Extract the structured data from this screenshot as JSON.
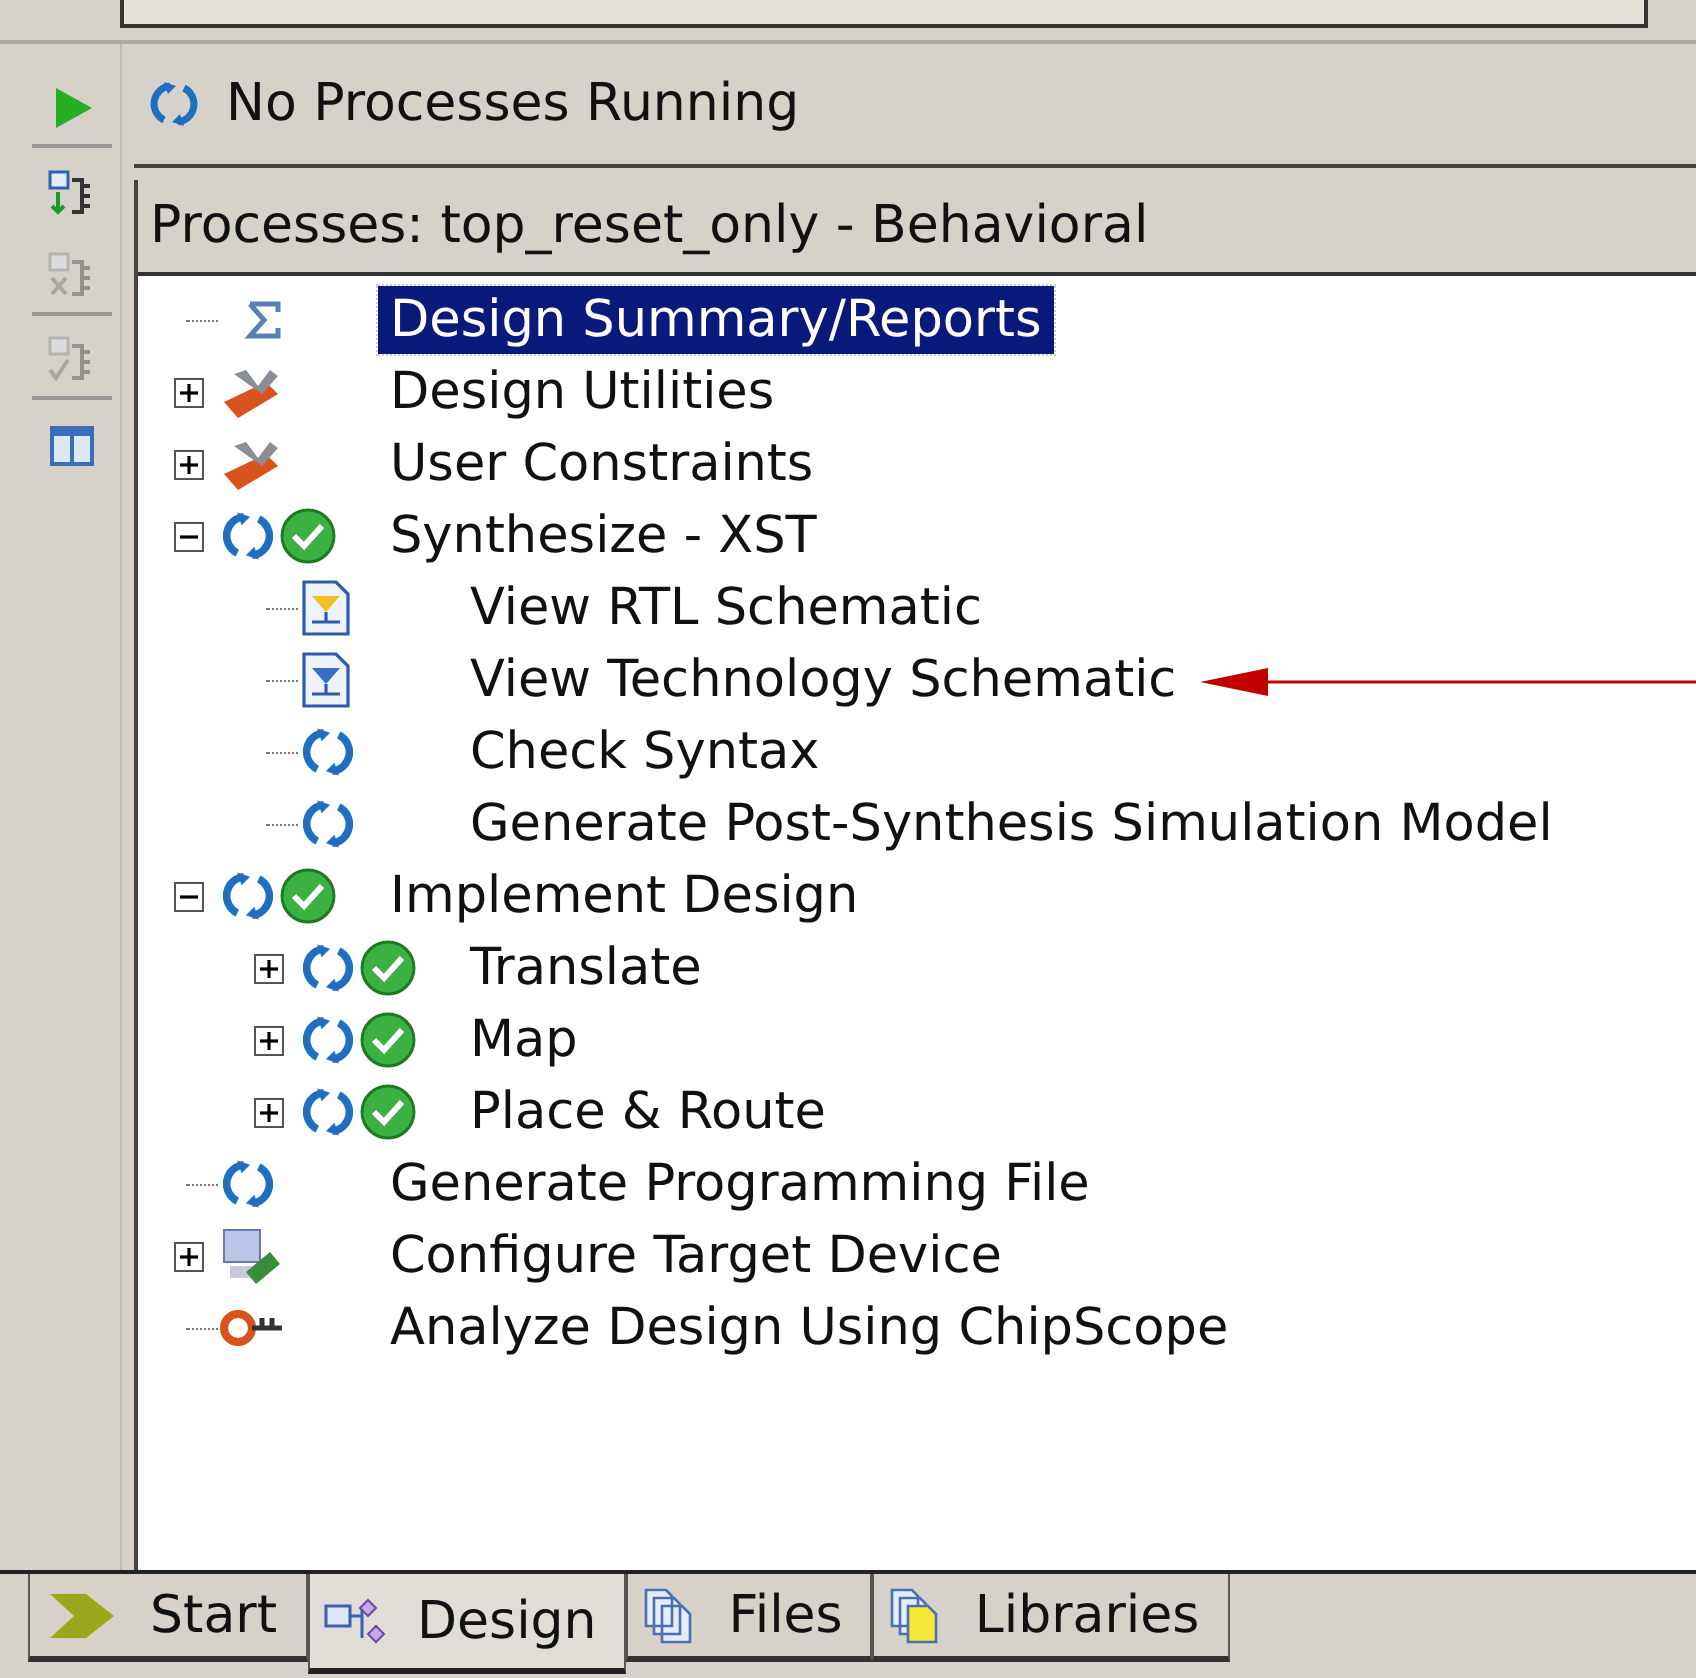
{
  "toolbar": [
    {
      "kind": "run",
      "disabled": false
    },
    {
      "kind": "implement-top",
      "disabled": false
    },
    {
      "kind": "rerun-all",
      "disabled": true
    },
    {
      "kind": "check-all",
      "disabled": true
    },
    {
      "kind": "panes",
      "disabled": false
    }
  ],
  "status": {
    "text": "No Processes Running"
  },
  "processes": {
    "title": "Processes: top_reset_only - Behavioral",
    "items": [
      {
        "label": "Design Summary/Reports",
        "kind": "summary",
        "selected": true
      },
      {
        "label": "Design Utilities",
        "kind": "tools",
        "selected": false,
        "expanded": false
      },
      {
        "label": "User Constraints",
        "kind": "tools",
        "selected": false,
        "expanded": false
      },
      {
        "label": "Synthesize - XST",
        "kind": "done",
        "selected": false,
        "expanded": true,
        "children": [
          {
            "label": "View RTL Schematic",
            "kind": "rtl",
            "selected": false
          },
          {
            "label": "View Technology Schematic",
            "kind": "tech",
            "selected": false
          },
          {
            "label": "Check Syntax",
            "kind": "process",
            "selected": false
          },
          {
            "label": "Generate Post-Synthesis Simulation Model",
            "kind": "process",
            "selected": false
          }
        ]
      },
      {
        "label": "Implement Design",
        "kind": "done",
        "selected": false,
        "expanded": true,
        "children": [
          {
            "label": "Translate",
            "kind": "done",
            "selected": false,
            "expanded": false
          },
          {
            "label": "Map",
            "kind": "done",
            "selected": false,
            "expanded": false
          },
          {
            "label": "Place & Route",
            "kind": "done",
            "selected": false,
            "expanded": false
          }
        ]
      },
      {
        "label": "Generate Programming File",
        "kind": "process",
        "selected": false
      },
      {
        "label": "Configure Target Device",
        "kind": "device",
        "selected": false,
        "expanded": false
      },
      {
        "label": "Analyze Design Using ChipScope",
        "kind": "chipscope",
        "selected": false
      }
    ]
  },
  "tabs": [
    {
      "label": "Start",
      "kind": "start",
      "selected": false
    },
    {
      "label": "Design",
      "kind": "design",
      "selected": true
    },
    {
      "label": "Files",
      "kind": "files",
      "selected": false
    },
    {
      "label": "Libraries",
      "kind": "libraries",
      "selected": false
    }
  ]
}
